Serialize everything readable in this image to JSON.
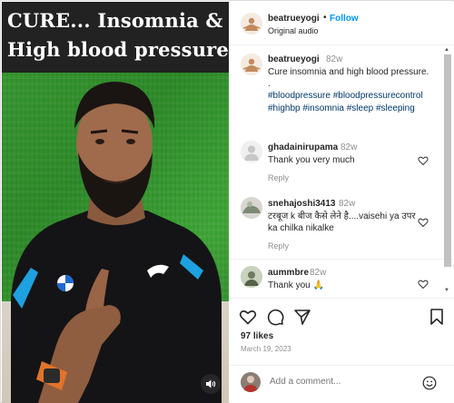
{
  "video": {
    "title_line1": "CURE... Insomnia &",
    "title_line2": "High blood pressure"
  },
  "header": {
    "username": "beatrueyogi",
    "separator": "•",
    "follow_label": "Follow",
    "audio_label": "Original audio",
    "more_label": "···"
  },
  "caption": {
    "username": "beatrueyogi",
    "time": "82w",
    "text": "Cure insomnia and high blood pressure. .",
    "hashtags": "#bloodpressure #bloodpressurecontrol #highbp #insomnia #sleep #sleeping"
  },
  "comments": [
    {
      "username": "ghadainirupama",
      "time": "82w",
      "text": "Thank you very much",
      "reply_label": "Reply"
    },
    {
      "username": "snehajoshi3413",
      "time": "82w",
      "text": "टरबूज k बीज कैसे लेने है....vaisehi ya उपर ka chilka nikalke",
      "reply_label": "Reply"
    },
    {
      "username": "aummbre",
      "time": "82w",
      "text": "Thank you 🙏",
      "reply_label": ""
    }
  ],
  "stats": {
    "likes": "97 likes",
    "date": "March 19, 2023"
  },
  "add_comment": {
    "placeholder": "Add a comment..."
  },
  "icons": {
    "like": "heart-icon",
    "comment": "comment-icon",
    "share": "share-icon",
    "save": "bookmark-icon",
    "sound": "speaker-icon",
    "emoji": "emoji-icon"
  },
  "colors": {
    "link_blue": "#0095f6",
    "hashtag": "#00376b",
    "muted": "#8e8e8e"
  }
}
